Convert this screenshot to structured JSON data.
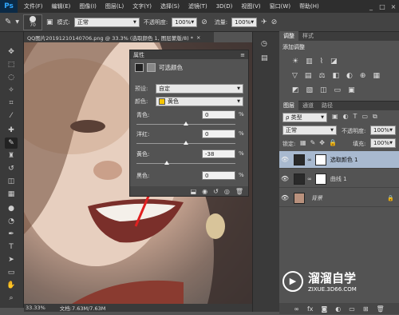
{
  "app": {
    "logo": "Ps"
  },
  "menu": [
    "文件(F)",
    "编辑(E)",
    "图像(I)",
    "图层(L)",
    "文字(Y)",
    "选择(S)",
    "滤镜(T)",
    "3D(D)",
    "视图(V)",
    "窗口(W)",
    "帮助(H)"
  ],
  "window_controls": [
    "_",
    "□",
    "×"
  ],
  "options": {
    "brush_size": "70",
    "mode_label": "模式:",
    "mode_value": "正常",
    "opacity_label": "不透明度:",
    "opacity_value": "100%",
    "flow_label": "流量:",
    "flow_value": "100%"
  },
  "document": {
    "tab_title": "QQ图片20191210140706.png @ 33.3% (选取颜色 1, 图层蒙版/8) *",
    "close": "×",
    "zoom": "33.33%",
    "doc_info": "文档:7.63M/7.63M"
  },
  "properties": {
    "title": "属性",
    "adjust_name": "可选颜色",
    "preset_label": "预设:",
    "preset_value": "自定",
    "colors_label": "颜色:",
    "colors_value": "黄色",
    "colors_swatch": "#f5c400",
    "sliders": [
      {
        "label": "青色:",
        "value": "0",
        "unit": "%",
        "level": 0
      },
      {
        "label": "洋红:",
        "value": "0",
        "unit": "%",
        "level": 0
      },
      {
        "label": "黄色:",
        "value": "-38",
        "unit": "%",
        "level": -38
      },
      {
        "label": "黑色:",
        "value": "0",
        "unit": "%",
        "level": 0
      }
    ]
  },
  "adjustments_panel": {
    "tabs": [
      "调整",
      "样式"
    ],
    "subtitle": "添加调整"
  },
  "layers_panel": {
    "tabs": [
      "图层",
      "通道",
      "路径"
    ],
    "filter": "ρ 类型",
    "blend_mode": "正常",
    "opacity_label": "不透明度:",
    "opacity_value": "100%",
    "lock_label": "锁定:",
    "fill_label": "填充:",
    "fill_value": "100%",
    "layers": [
      {
        "name": "选取颜色 1",
        "selected": true
      },
      {
        "name": "曲线 1",
        "selected": false
      },
      {
        "name": "背景",
        "selected": false
      }
    ]
  },
  "watermark": {
    "brand": "溜溜自学",
    "url": "ZIXUE.3D66.COM"
  },
  "colors": {
    "accent": "#31a8ff",
    "annotation_arrow": "#e02020"
  }
}
